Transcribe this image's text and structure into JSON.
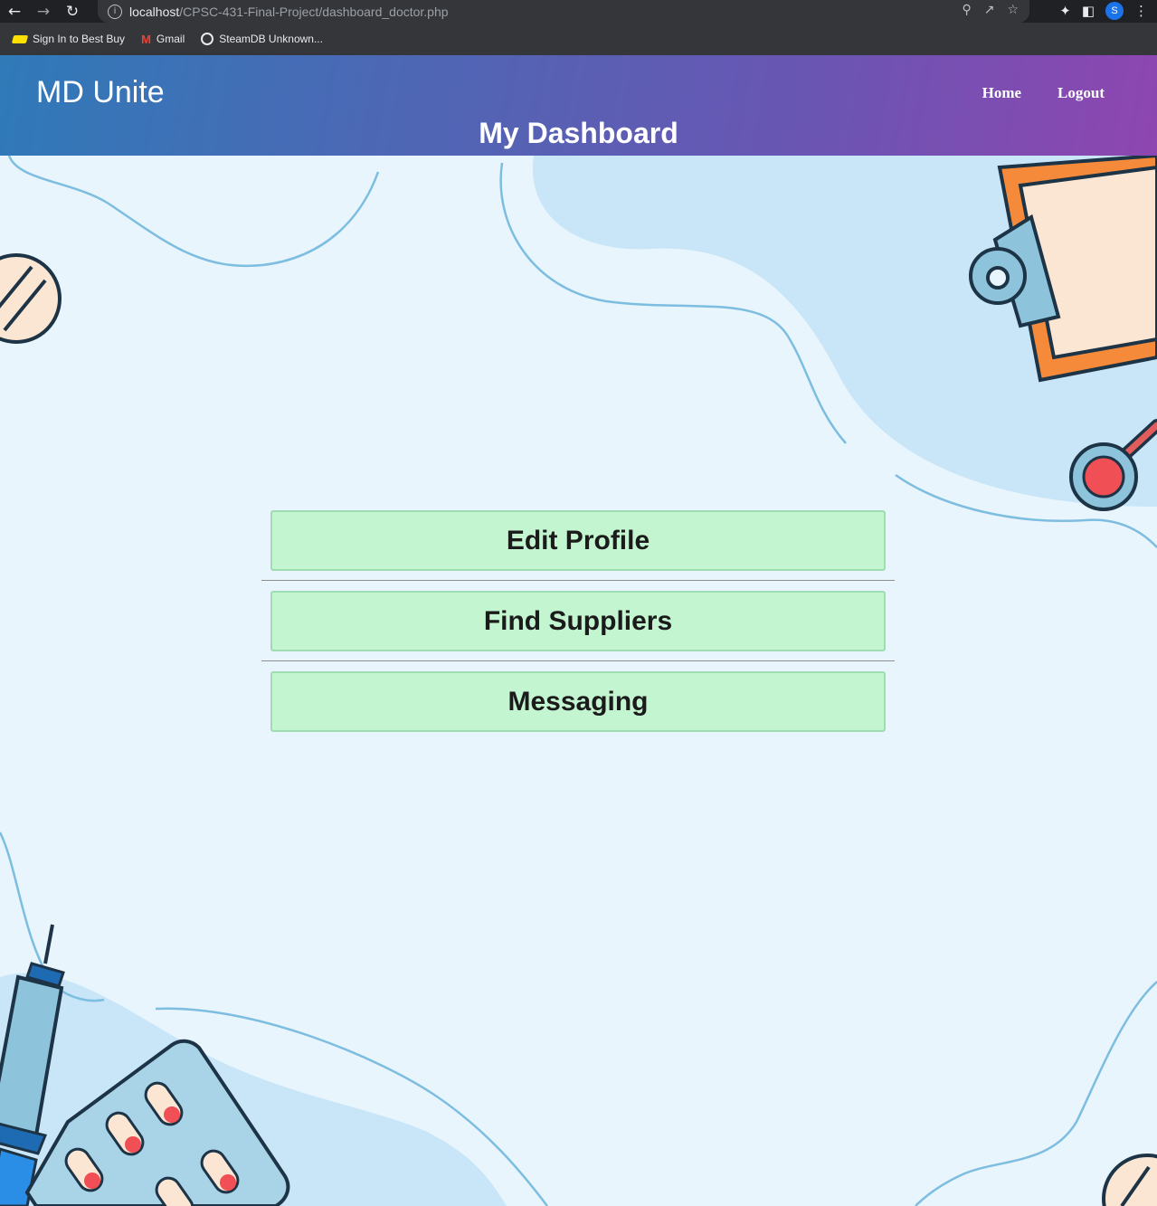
{
  "browser": {
    "url_host": "localhost",
    "url_path": "/CPSC-431-Final-Project/dashboard_doctor.php",
    "profile_initial": "S",
    "bookmarks": [
      {
        "label": "Sign In to Best Buy",
        "icon": "bestbuy-tag-icon"
      },
      {
        "label": "Gmail",
        "icon": "gmail-icon"
      },
      {
        "label": "SteamDB Unknown...",
        "icon": "steamdb-icon"
      }
    ]
  },
  "header": {
    "brand": "MD Unite",
    "nav": [
      {
        "label": "Home"
      },
      {
        "label": "Logout"
      }
    ],
    "title": "My Dashboard",
    "gradient_start": "#2f7ab8",
    "gradient_end": "#8e46b0"
  },
  "menu": {
    "buttons": [
      {
        "label": "Edit Profile"
      },
      {
        "label": "Find Suppliers"
      },
      {
        "label": "Messaging"
      }
    ],
    "button_color": "#c3f5d1"
  }
}
